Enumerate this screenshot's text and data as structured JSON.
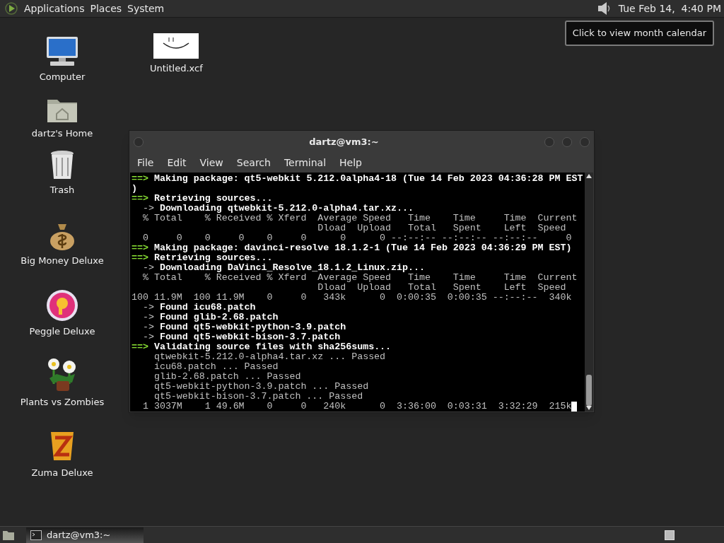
{
  "top_panel": {
    "menus": [
      "Applications",
      "Places",
      "System"
    ],
    "clock": "Tue Feb 14,  4:40 PM",
    "tooltip": "Click to view month calendar"
  },
  "desktop_icons": [
    {
      "label": "Computer",
      "kind": "computer"
    },
    {
      "label": "dartz's Home",
      "kind": "home"
    },
    {
      "label": "Trash",
      "kind": "trash"
    },
    {
      "label": "Big Money Deluxe",
      "kind": "money"
    },
    {
      "label": "Peggle Deluxe",
      "kind": "peggle"
    },
    {
      "label": "Plants vs Zombies",
      "kind": "plants"
    },
    {
      "label": "Zuma Deluxe",
      "kind": "zuma"
    }
  ],
  "file_icon": {
    "label": "Untitled.xcf",
    "kind": "picture"
  },
  "terminal": {
    "title": "dartz@vm3:~",
    "menu": [
      "File",
      "Edit",
      "View",
      "Search",
      "Terminal",
      "Help"
    ],
    "lines": [
      {
        "kind": "heading",
        "marker": "==>",
        "text": "Making package: qt5-webkit 5.212.0alpha4-18 (Tue 14 Feb 2023 04:36:28 PM EST"
      },
      {
        "kind": "continued",
        "text": ")"
      },
      {
        "kind": "heading",
        "marker": "==>",
        "text": "Retrieving sources..."
      },
      {
        "kind": "step",
        "marker": "->",
        "text": "Downloading qtwebkit-5.212.0-alpha4.tar.xz..."
      },
      {
        "kind": "output",
        "text": "  % Total    % Received % Xferd  Average Speed   Time    Time     Time  Current"
      },
      {
        "kind": "output",
        "text": "                                 Dload  Upload   Total   Spent    Left  Speed"
      },
      {
        "kind": "output",
        "text": "  0     0    0     0    0     0      0      0 --:--:-- --:--:-- --:--:--     0"
      },
      {
        "kind": "heading",
        "marker": "==>",
        "text": "Making package: davinci-resolve 18.1.2-1 (Tue 14 Feb 2023 04:36:29 PM EST)"
      },
      {
        "kind": "heading",
        "marker": "==>",
        "text": "Retrieving sources..."
      },
      {
        "kind": "step",
        "marker": "->",
        "text": "Downloading DaVinci_Resolve_18.1.2_Linux.zip..."
      },
      {
        "kind": "output",
        "text": "  % Total    % Received % Xferd  Average Speed   Time    Time     Time  Current"
      },
      {
        "kind": "output",
        "text": "                                 Dload  Upload   Total   Spent    Left  Speed"
      },
      {
        "kind": "output",
        "text": "100 11.9M  100 11.9M    0     0   343k      0  0:00:35  0:00:35 --:--:--  340k"
      },
      {
        "kind": "step",
        "marker": "->",
        "text": "Found icu68.patch"
      },
      {
        "kind": "step",
        "marker": "->",
        "text": "Found glib-2.68.patch"
      },
      {
        "kind": "step",
        "marker": "->",
        "text": "Found qt5-webkit-python-3.9.patch"
      },
      {
        "kind": "step",
        "marker": "->",
        "text": "Found qt5-webkit-bison-3.7.patch"
      },
      {
        "kind": "heading",
        "marker": "==>",
        "text": "Validating source files with sha256sums..."
      },
      {
        "kind": "output",
        "text": "    qtwebkit-5.212.0-alpha4.tar.xz ... Passed"
      },
      {
        "kind": "output",
        "text": "    icu68.patch ... Passed"
      },
      {
        "kind": "output",
        "text": "    glib-2.68.patch ... Passed"
      },
      {
        "kind": "output",
        "text": "    qt5-webkit-python-3.9.patch ... Passed"
      },
      {
        "kind": "output",
        "text": "    qt5-webkit-bison-3.7.patch ... Passed"
      },
      {
        "kind": "output",
        "text": "  1 3037M    1 49.6M    0     0   240k      0  3:36:00  0:03:31  3:32:29  215k",
        "cursor": true
      }
    ]
  },
  "taskbar": {
    "tasks": [
      {
        "label": "dartz@vm3:~",
        "selected": true
      }
    ]
  }
}
